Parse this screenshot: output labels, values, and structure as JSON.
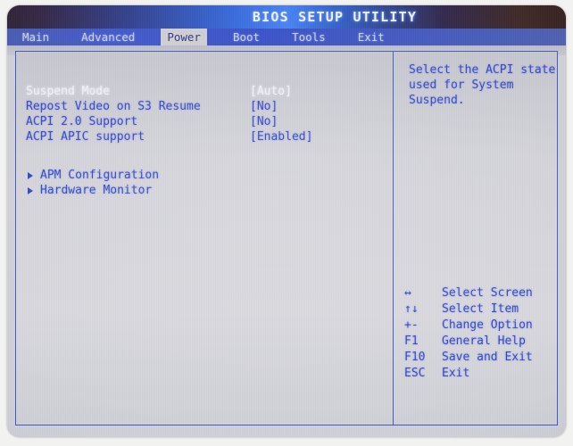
{
  "window": {
    "title": "BIOS SETUP UTILITY"
  },
  "menubar": {
    "tabs": [
      {
        "label": "Main",
        "active": false
      },
      {
        "label": "Advanced",
        "active": false
      },
      {
        "label": "Power",
        "active": true
      },
      {
        "label": "Boot",
        "active": false
      },
      {
        "label": "Tools",
        "active": false
      },
      {
        "label": "Exit",
        "active": false
      }
    ]
  },
  "settings": [
    {
      "label": "Suspend Mode",
      "value": "[Auto]",
      "selected": true
    },
    {
      "label": "Repost Video on S3 Resume",
      "value": "[No]",
      "selected": false
    },
    {
      "label": "ACPI 2.0 Support",
      "value": "[No]",
      "selected": false
    },
    {
      "label": "ACPI APIC support",
      "value": "[Enabled]",
      "selected": false
    }
  ],
  "submenus": [
    {
      "label": "APM Configuration"
    },
    {
      "label": "Hardware Monitor"
    }
  ],
  "help": {
    "lines": [
      "Select the ACPI state",
      "used for System",
      "Suspend."
    ]
  },
  "key_legend": [
    {
      "glyph": "↔",
      "desc": "Select Screen"
    },
    {
      "glyph": "↑↓",
      "desc": "Select Item"
    },
    {
      "glyph": "+-",
      "desc": "Change Option"
    },
    {
      "glyph": "F1",
      "desc": "General Help"
    },
    {
      "glyph": "F10",
      "desc": "Save and Exit"
    },
    {
      "glyph": "ESC",
      "desc": "Exit"
    }
  ],
  "colors": {
    "accent_blue": "#2b3fc4",
    "menubar_blue": "#3b53c8",
    "active_tab_bg": "#cdcdd2",
    "screen_bg": "#d2d2d8",
    "selected_text": "#f3f3f6"
  }
}
